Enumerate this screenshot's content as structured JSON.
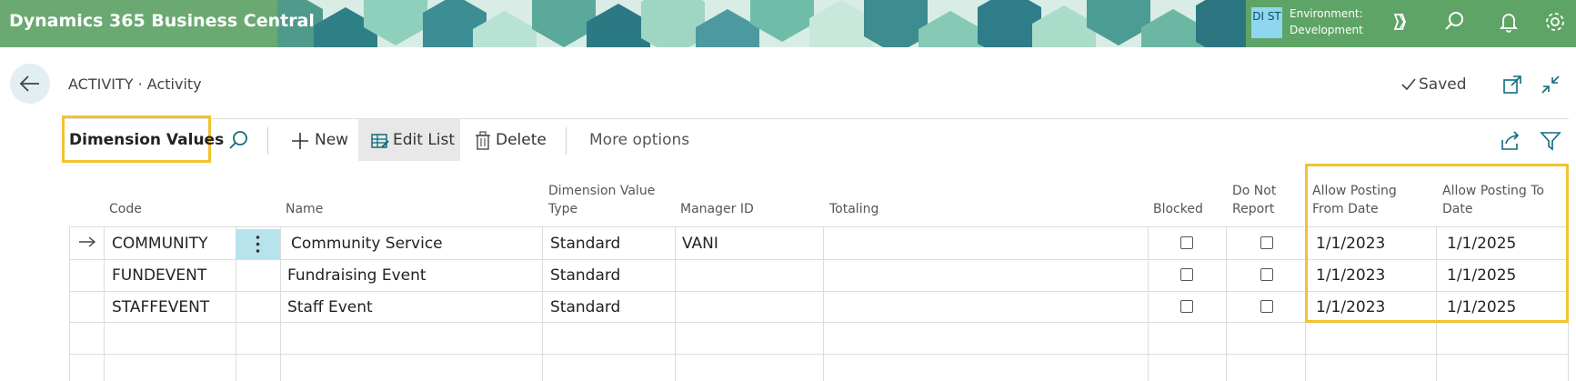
{
  "app": {
    "title": "Dynamics 365 Business Central",
    "env_badge": "DI ST",
    "env_label": "Environment:",
    "env_value": "Development"
  },
  "header": {
    "breadcrumb": "ACTIVITY · Activity",
    "saved_label": "Saved"
  },
  "actionbar": {
    "page_label": "Dimension Values",
    "new_label": "New",
    "edit_list_label": "Edit List",
    "delete_label": "Delete",
    "more_options_label": "More options"
  },
  "table": {
    "columns": {
      "code": "Code",
      "name": "Name",
      "dim_type": "Dimension Value Type",
      "manager": "Manager ID",
      "totaling": "Totaling",
      "blocked": "Blocked",
      "do_not_report": "Do Not Report",
      "allow_from": "Allow Posting From Date",
      "allow_to": "Allow Posting To Date"
    },
    "rows": [
      {
        "code": "COMMUNITY",
        "name": "Community Service",
        "type": "Standard",
        "manager": "VANI",
        "totaling": "",
        "blocked": false,
        "do_not_report": false,
        "from": "1/1/2023",
        "to": "1/1/2025"
      },
      {
        "code": "FUNDEVENT",
        "name": "Fundraising Event",
        "type": "Standard",
        "manager": "",
        "totaling": "",
        "blocked": false,
        "do_not_report": false,
        "from": "1/1/2023",
        "to": "1/1/2025"
      },
      {
        "code": "STAFFEVENT",
        "name": "Staff Event",
        "type": "Standard",
        "manager": "",
        "totaling": "",
        "blocked": false,
        "do_not_report": false,
        "from": "1/1/2023",
        "to": "1/1/2025"
      }
    ]
  },
  "colors": {
    "brand_green": "#6aa971",
    "highlight": "#f2c230",
    "accent": "#0f6c7e"
  }
}
